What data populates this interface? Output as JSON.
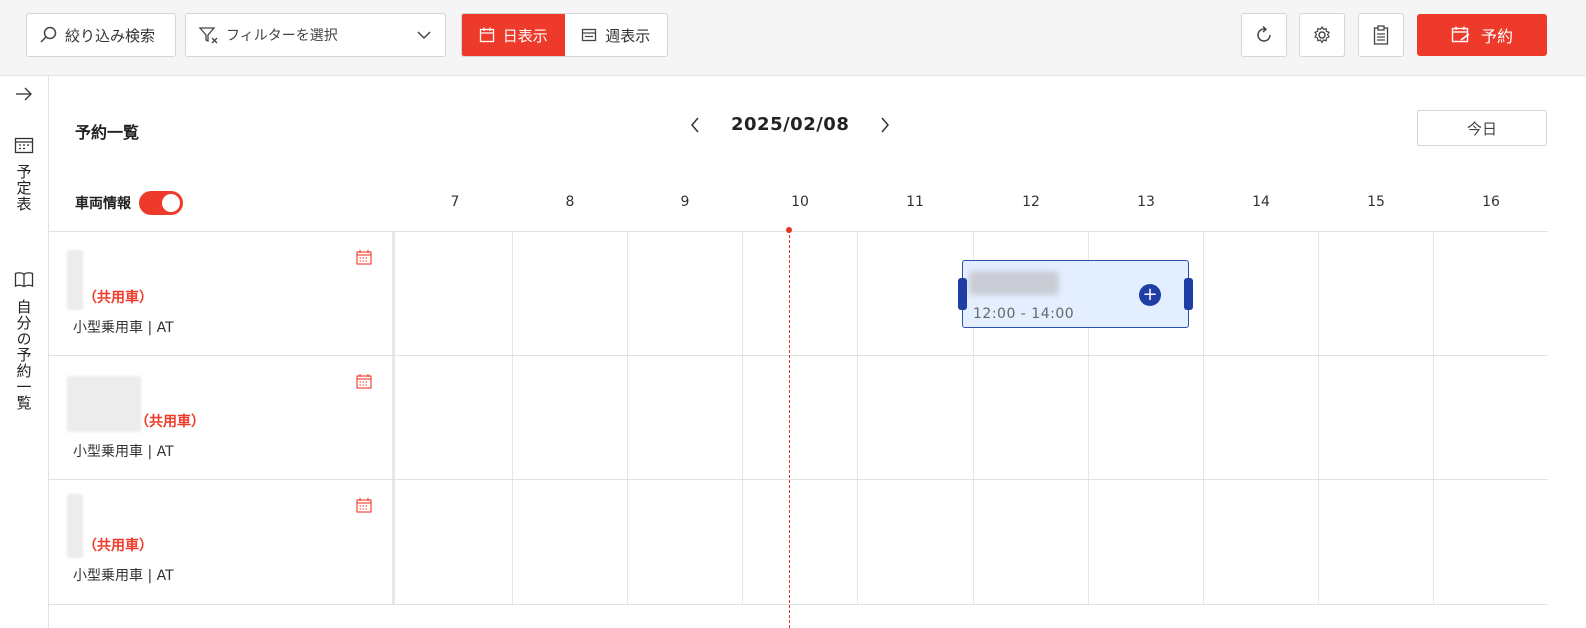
{
  "toolbar": {
    "search_label": "絞り込み検索",
    "filter_placeholder": "フィルターを選択",
    "day_view_label": "日表示",
    "week_view_label": "週表示",
    "reserve_label": "予約"
  },
  "sidebar": {
    "items": [
      {
        "label": "予定表",
        "icon": "calendar-icon"
      },
      {
        "label": "自分の予約一覧",
        "icon": "book-icon"
      }
    ]
  },
  "main": {
    "title": "予約一覧",
    "date": "2025/02/08",
    "today_label": "今日",
    "vehicle_info_label": "車両情報",
    "vehicle_info_toggle": true,
    "hours": [
      "7",
      "8",
      "9",
      "10",
      "11",
      "12",
      "13",
      "14",
      "15",
      "16"
    ]
  },
  "vehicles": [
    {
      "name_suffix": "（共用車）",
      "type": "小型乗用車 | AT"
    },
    {
      "name_suffix": "（共用車）",
      "type": "小型乗用車 | AT"
    },
    {
      "name_suffix": "（共用車）",
      "type": "小型乗用車 | AT"
    }
  ],
  "bookings": [
    {
      "vehicle": 0,
      "start": "12:00",
      "end": "14:00",
      "time_label": "12:00 - 14:00"
    }
  ],
  "colors": {
    "accent": "#ee3a2b",
    "booking_border": "#2a4fb0",
    "booking_bg": "#e3efff",
    "now_line": "#e53222"
  }
}
